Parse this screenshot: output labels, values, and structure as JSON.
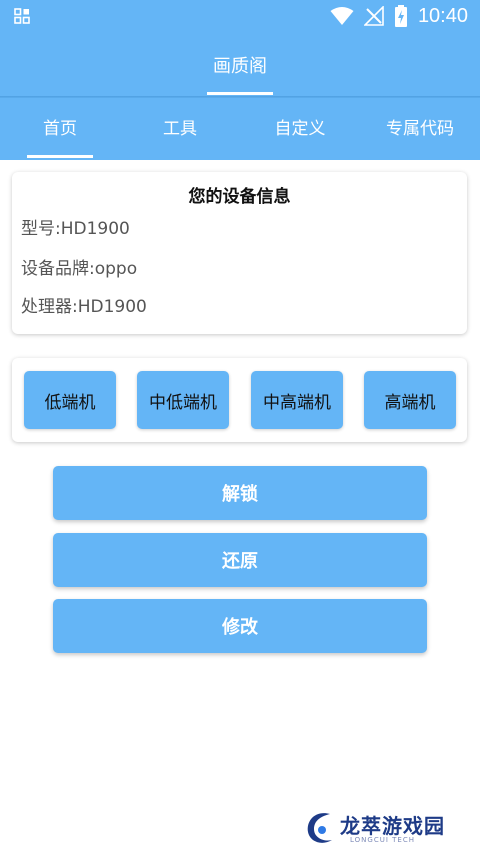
{
  "status_bar": {
    "time": "10:40",
    "icons": [
      "app-grid-icon",
      "wifi-icon",
      "no-signal-icon",
      "battery-charging-icon"
    ]
  },
  "app_bar": {
    "title": "画质阁"
  },
  "tabs": [
    {
      "label": "首页",
      "selected": true
    },
    {
      "label": "工具",
      "selected": false
    },
    {
      "label": "自定义",
      "selected": false
    },
    {
      "label": "专属代码",
      "selected": false
    }
  ],
  "device_info": {
    "title": "您的设备信息",
    "model": "型号:HD1900",
    "brand": "设备品牌:oppo",
    "processor": "处理器:HD1900"
  },
  "tiers": [
    "低端机",
    "中低端机",
    "中高端机",
    "高端机"
  ],
  "actions": {
    "unlock": "解锁",
    "restore": "还原",
    "modify": "修改"
  },
  "watermark": {
    "text": "龙萃游戏园",
    "sub": "LONGCUI TECH"
  },
  "colors": {
    "primary": "#64b5f6",
    "text_dark": "#111111",
    "text_gray": "#555555"
  }
}
